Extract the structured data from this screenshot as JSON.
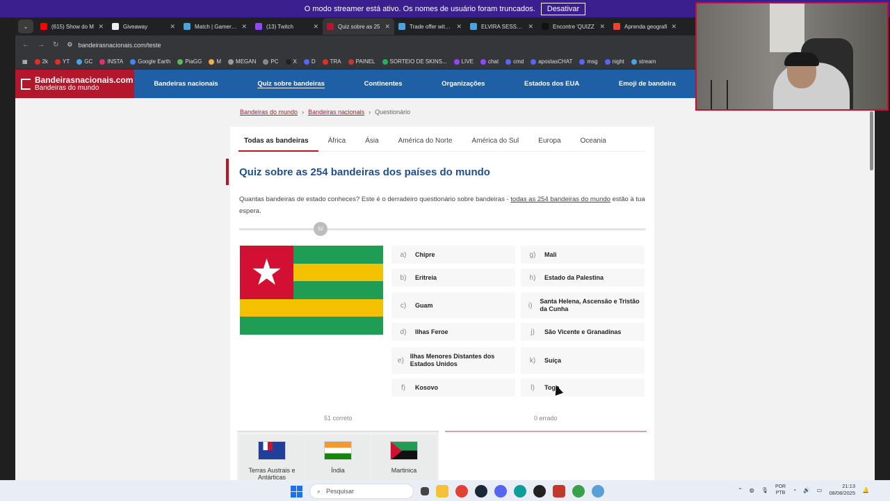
{
  "streamer": {
    "message": "O modo streamer está ativo. Os nomes de usuário foram truncados.",
    "button": "Desativar"
  },
  "browser": {
    "tabs": [
      {
        "title": "(615) Show do M",
        "color": "#ff0000"
      },
      {
        "title": "Giveaway",
        "color": "#eeeeee"
      },
      {
        "title": "Match | Gamers C",
        "color": "#4aa3df"
      },
      {
        "title": "(13) Twitch",
        "color": "#9146ff"
      },
      {
        "title": "Quiz sobre as 25",
        "color": "#b2172c"
      },
      {
        "title": "Trade offer with D",
        "color": "#4aa3df"
      },
      {
        "title": "ELVIRA SESSAO U",
        "color": "#4aa3df"
      },
      {
        "title": "Encontre 'QUIZZ",
        "color": "#111111"
      },
      {
        "title": "Aprenda geografi",
        "color": "#ea4335"
      }
    ],
    "url": "bandeirasnacionais.com/teste",
    "bookmarks": [
      "2k",
      "YT",
      "GC",
      "INSTA",
      "Google Earth",
      "PiaGG",
      "M",
      "MEGAN",
      "PC",
      "X",
      "D",
      "TRA",
      "PAINEL",
      "SORTEIO DE SKINS...",
      "LIVE",
      "chat",
      "cmd",
      "apostasCHAT",
      "msg",
      "night",
      "stream"
    ]
  },
  "site": {
    "logo_title": "Bandeirasnacionais.com",
    "logo_subtitle": "Bandeiras do mundo",
    "nav": [
      "Bandeiras nacionais",
      "Quiz sobre bandeiras",
      "Continentes",
      "Organizações",
      "Estados dos EUA",
      "Emoji de bandeira"
    ],
    "breadcrumb": [
      "Bandeiras do mundo",
      "Bandeiras nacionais",
      "Questionário"
    ],
    "region_tabs": [
      "Todas as bandeiras",
      "África",
      "Ásia",
      "América do Norte",
      "América do Sul",
      "Europa",
      "Oceania"
    ],
    "quiz_title": "Quiz sobre as 254 bandeiras dos países do mundo",
    "intro_before": "Quantas bandeiras de estado conheces? Este é o derradeiro questionário sobre bandeiras - ",
    "intro_link": "todas as 254 bandeiras do mundo",
    "intro_after": " estão à tua espera.",
    "progress_label": "52",
    "progress_value": 0.2,
    "flag_name": "Togo",
    "flag_colors": {
      "green": "#1f9d55",
      "yellow": "#f2c200",
      "red": "#d21034"
    },
    "options": [
      {
        "letter": "a)",
        "name": "Chipre"
      },
      {
        "letter": "b)",
        "name": "Eritreia"
      },
      {
        "letter": "c)",
        "name": "Guam"
      },
      {
        "letter": "d)",
        "name": "Ilhas Feroe"
      },
      {
        "letter": "e)",
        "name": "Ilhas Menores Distantes dos Estados Unidos"
      },
      {
        "letter": "f)",
        "name": "Kosovo"
      },
      {
        "letter": "g)",
        "name": "Mali"
      },
      {
        "letter": "h)",
        "name": "Estado da Palestina"
      },
      {
        "letter": "i)",
        "name": "Santa Helena, Ascensão e Tristão da Cunha"
      },
      {
        "letter": "j)",
        "name": "São Vicente e Granadinas"
      },
      {
        "letter": "k)",
        "name": "Suíça"
      },
      {
        "letter": "l)",
        "name": "Togo"
      }
    ],
    "correct_label": "51 correto",
    "wrong_label": "0 errado",
    "correct_answers": [
      "Terras Austrais e Antárticas",
      "Índia",
      "Martinica"
    ]
  },
  "taskbar": {
    "search": "Pesquisar",
    "lang1": "POR",
    "lang2": "PTB",
    "time": "21:13",
    "date": "08/08/2025"
  }
}
